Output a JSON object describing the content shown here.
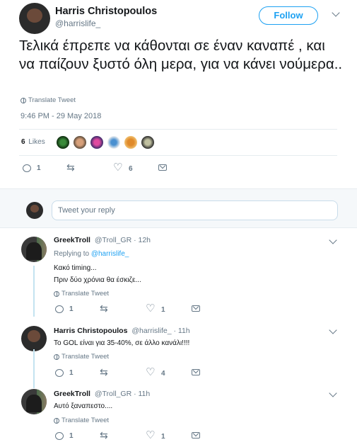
{
  "tweet": {
    "author_name": "Harris Christopoulos",
    "author_handle": "@harrislife_",
    "follow_label": "Follow",
    "text": "Τελικά έπρεπε να κάθονται σε έναν καναπέ , και να παίζουν ξυστό όλη μερα, για να κάνει νούμερα..",
    "translate_label": "Translate Tweet",
    "timestamp": "9:46 PM - 29 May 2018",
    "likes_count": "6",
    "likes_label": "Likes",
    "actions": {
      "replies": "1",
      "retweets": "",
      "likes": "6"
    }
  },
  "reply_box": {
    "placeholder": "Tweet your reply"
  },
  "replies": [
    {
      "name": "GreekTroll",
      "handle": "@Troll_GR",
      "time": "· 12h",
      "replying_prefix": "Replying to",
      "replying_to": "@harrislife_",
      "lines": [
        "Κακό timing...",
        "Πριν δύο χρόνια θα έσκιζε..."
      ],
      "translate_label": "Translate Tweet",
      "actions": {
        "replies": "1",
        "retweets": "",
        "likes": "1"
      }
    },
    {
      "name": "Harris Christopoulos",
      "handle": "@harrislife_",
      "time": "· 11h",
      "lines": [
        "Το GOL είναι για 35-40%, σε άλλο κανάλι!!!!"
      ],
      "translate_label": "Translate Tweet",
      "actions": {
        "replies": "1",
        "retweets": "",
        "likes": "4"
      }
    },
    {
      "name": "GreekTroll",
      "handle": "@Troll_GR",
      "time": "· 11h",
      "lines": [
        "Αυτό ξαναπεστο...."
      ],
      "translate_label": "Translate Tweet",
      "actions": {
        "replies": "1",
        "retweets": "",
        "likes": "1"
      }
    }
  ],
  "colors": {
    "accent": "#1da1f2",
    "muted": "#657786",
    "thread_line": "#c4e3f0"
  }
}
